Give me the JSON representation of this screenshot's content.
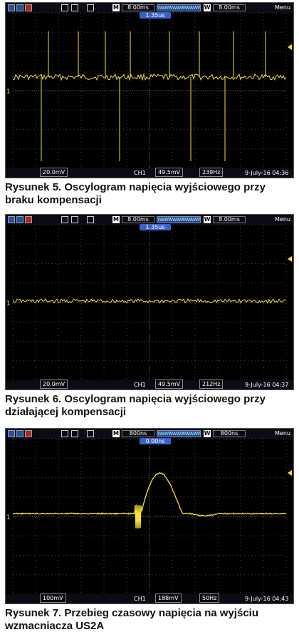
{
  "trace_color": "#f5e13a",
  "screens": [
    {
      "id": "rys5",
      "timebase": "8.00ms",
      "wave_window": "8.00ms",
      "menu": "Menu",
      "delay": "1.35us",
      "ch1_scale": "20.0mV",
      "trigger": "49.5mV",
      "frequency": "239Hz",
      "date": "9-July-16 04:36",
      "caption_line1": "Rysunek 5. Oscylogram napięcia wyjściowego przy",
      "caption_line2": "braku kompensacji"
    },
    {
      "id": "rys6",
      "timebase": "8.00ms",
      "wave_window": "8.00ms",
      "menu": "Menu",
      "delay": "1.35us",
      "ch1_scale": "20.0mV",
      "trigger": "49.5mV",
      "frequency": "212Hz",
      "date": "9-July-16 04:37",
      "caption_line1": "Rysunek 6. Oscylogram napięcia wyjściowego przy",
      "caption_line2": "działającej kompensacji"
    },
    {
      "id": "rys7",
      "timebase": "800ns",
      "wave_window": "800ns",
      "menu": "Menu",
      "delay": "0.00ns",
      "ch1_scale": "100mV",
      "trigger": "188mV",
      "frequency": "50Hz",
      "date": "9-July-16 04:43",
      "caption_line1": "Rysunek 7. Przebieg czasowy napięcia na wyjściu",
      "caption_line2": "wzmacniacza US2A"
    }
  ],
  "labels": {
    "ch1": "CH1",
    "m": "M",
    "w": "W",
    "trig_marker": "1"
  }
}
